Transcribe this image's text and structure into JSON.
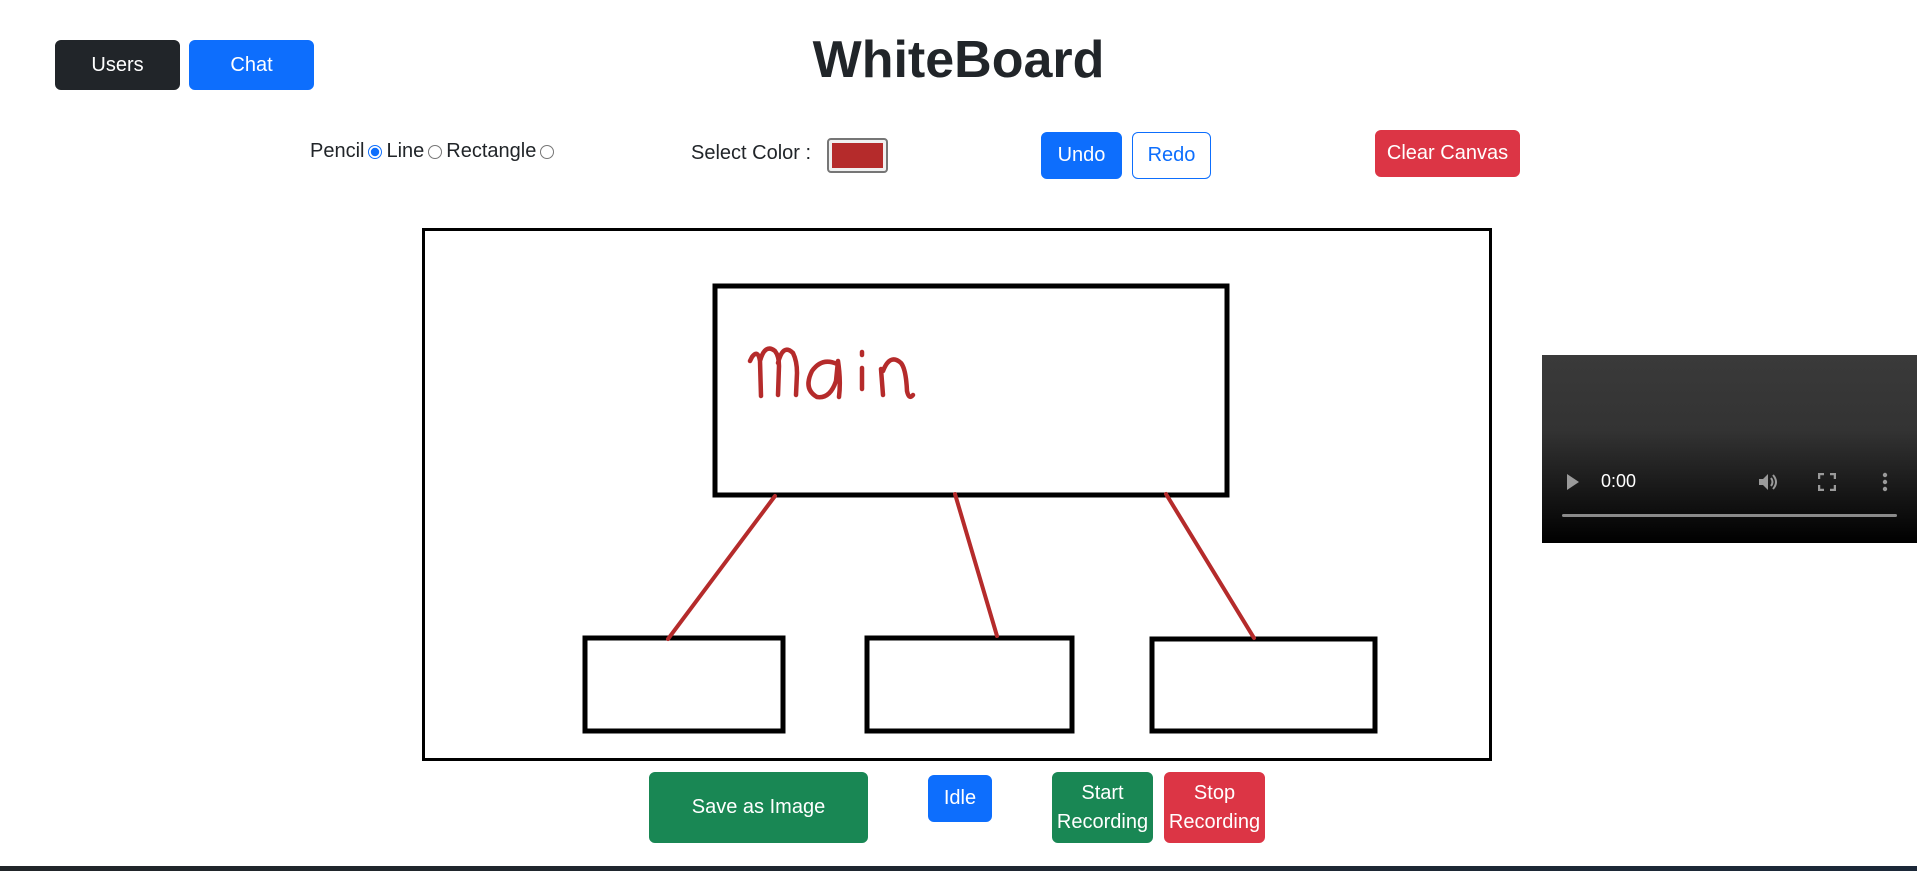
{
  "header": {
    "title": "WhiteBoard",
    "users_label": "Users",
    "chat_label": "Chat"
  },
  "toolbar": {
    "tools": [
      {
        "label": "Pencil",
        "selected": true
      },
      {
        "label": "Line",
        "selected": false
      },
      {
        "label": "Rectangle",
        "selected": false
      }
    ],
    "color_label": "Select Color :",
    "selected_color": "#b52b2b",
    "undo_label": "Undo",
    "redo_label": "Redo",
    "clear_label": "Clear Canvas"
  },
  "canvas": {
    "handwritten_text": "main",
    "stroke_color": "#b52b2b",
    "shape_color": "#000000"
  },
  "video": {
    "current_time": "0:00"
  },
  "actions": {
    "save_label": "Save as Image",
    "status_label": "Idle",
    "start_recording_label": "Start Recording",
    "stop_recording_label": "Stop Recording"
  },
  "colors": {
    "primary": "#0d6efd",
    "dark": "#212529",
    "danger": "#dc3545",
    "success": "#198754"
  }
}
